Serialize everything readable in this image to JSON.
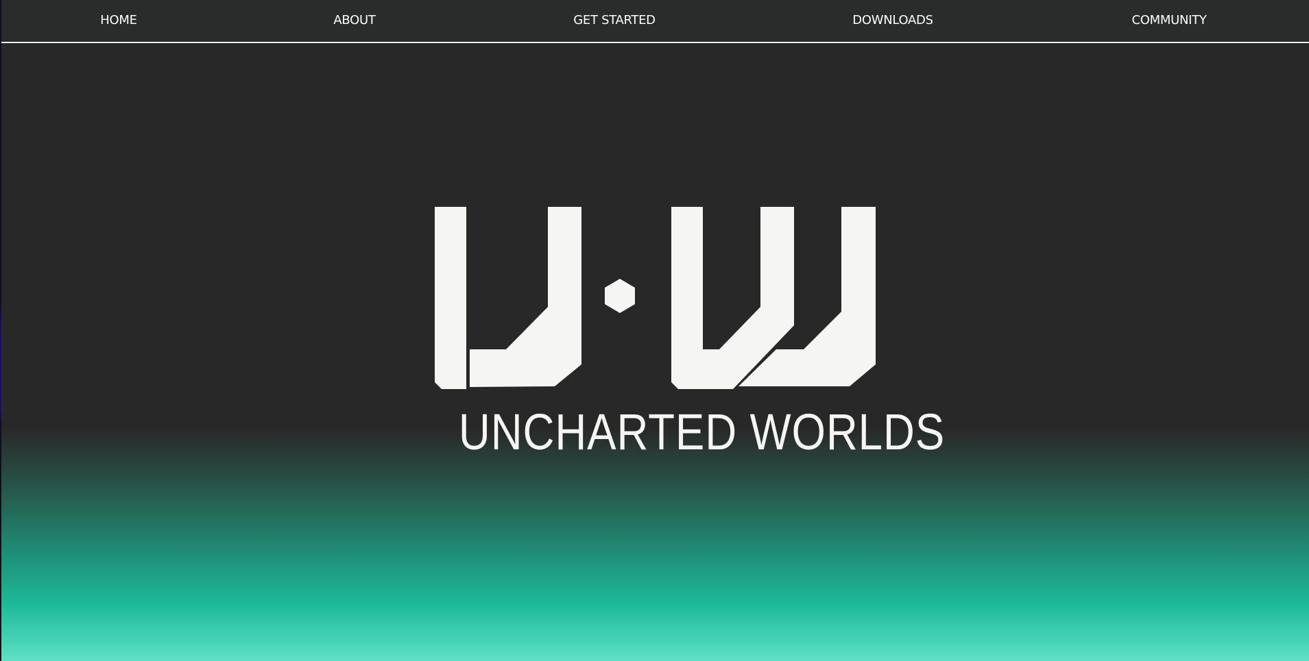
{
  "nav": {
    "items": [
      "HOME",
      "ABOUT",
      "GET STARTED",
      "DOWNLOADS",
      "COMMUNITY"
    ]
  },
  "hero": {
    "logo_icon": "uw-monogram-logo",
    "title": "UNCHARTED WORLDS"
  },
  "colors": {
    "nav_background": "#2a2c2c",
    "page_background": "#282828",
    "gradient_mid": "#1cb898",
    "gradient_bottom": "#5ee1c6",
    "text": "#f5f5f3"
  }
}
